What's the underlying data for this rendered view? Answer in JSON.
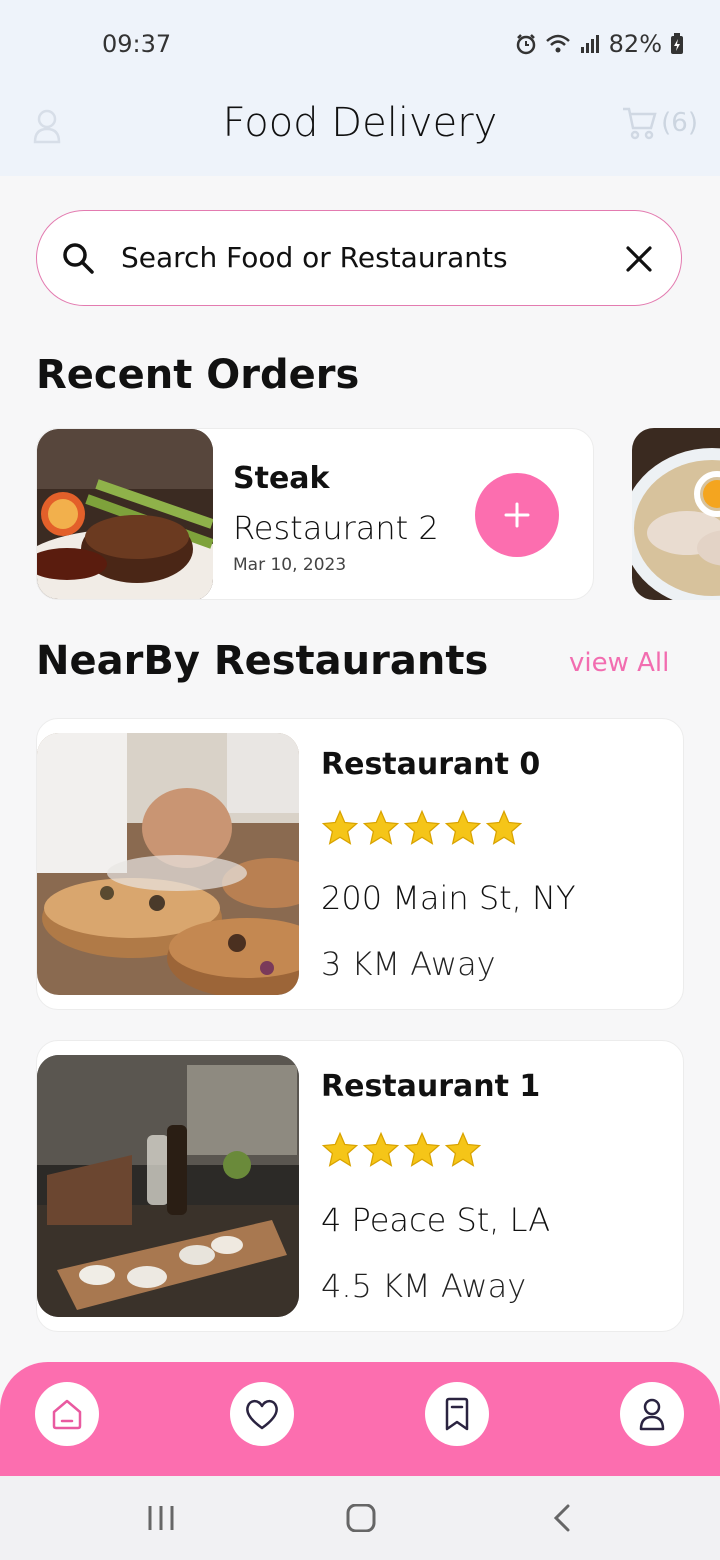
{
  "status": {
    "time": "09:37",
    "battery": "82%"
  },
  "header": {
    "title": "Food Delivery",
    "cart_count": "(6)"
  },
  "search": {
    "placeholder": "Search Food or Restaurants"
  },
  "recent_orders": {
    "title": "Recent Orders",
    "items": [
      {
        "name": "Steak",
        "restaurant": "Restaurant 2",
        "date": "Mar 10, 2023"
      }
    ]
  },
  "nearby": {
    "title": "NearBy Restaurants",
    "view_all": "view All",
    "items": [
      {
        "name": "Restaurant 0",
        "rating": 5,
        "address": "200 Main St, NY",
        "distance": "3 KM Away"
      },
      {
        "name": "Restaurant 1",
        "rating": 4,
        "address": "4 Peace St, LA",
        "distance": "4.5 KM Away"
      }
    ]
  },
  "colors": {
    "accent": "#fc6eaf",
    "header_bg": "#eef3fa",
    "star": "#f5c518"
  },
  "bottom_nav": [
    "home-icon",
    "heart-icon",
    "bookmark-icon",
    "user-icon"
  ]
}
